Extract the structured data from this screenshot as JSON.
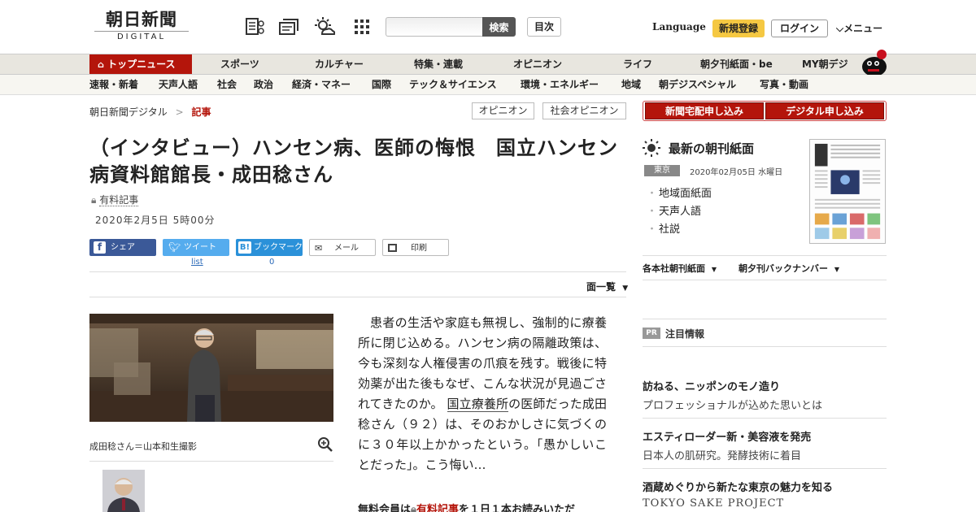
{
  "header": {
    "logo_main": "朝日新聞",
    "logo_sub": "DIGITAL",
    "search_button": "検索",
    "search_placeholder": "",
    "toc_button": "目次",
    "language": "Language",
    "signup": "新規登録",
    "login": "ログイン",
    "menu": "メニュー"
  },
  "nav_primary": [
    "トップニュース",
    "スポーツ",
    "カルチャー",
    "特集・連載",
    "オピニオン",
    "ライフ",
    "朝夕刊紙面・be",
    "MY朝デジ"
  ],
  "nav_secondary": [
    "速報・新着",
    "天声人語",
    "社会",
    "政治",
    "経済・マネー",
    "国際",
    "テック＆サイエンス",
    "環境・エネルギー",
    "地域",
    "朝デジスペシャル",
    "写真・動画"
  ],
  "breadcrumb": {
    "home": "朝日新聞デジタル",
    "separator": ">",
    "current": "記事"
  },
  "tags": [
    "オピニオン",
    "社会オピニオン"
  ],
  "article": {
    "headline": "（インタビュー）ハンセン病、医師の悔恨　国立ハンセン病資料館館長・成田稔さん",
    "paid_label": "有料記事",
    "date": "2020年2月5日 5時00分",
    "share": {
      "facebook": "シェア",
      "twitter": "ツイート",
      "hatena": "ブックマーク",
      "mail": "メール",
      "print": "印刷",
      "twitter_count": "list",
      "hatena_count": "0"
    },
    "page_list": "面一覧",
    "caption": "成田稔さん＝山本和生撮影",
    "body_before_link": "患者の生活や家庭も無視し、強制的に療養所に閉じ込める。ハンセン病の隔離政策は、今も深刻な人権侵害の爪痕を残す。戦後に特効薬が出た後もなぜ、こんな状況が見過ごされてきたのか。",
    "body_link": "国立療養所",
    "body_after_link": "の医師だった成田稔さん（９２）は、そのおかしさに気づくのに３０年以上かかったという。「愚かしいことだった」。こう悔い…",
    "free_note_a": "無料会員は",
    "free_note_link": "有料記事",
    "free_note_b": "を１日１本お読みいただ"
  },
  "sidebar": {
    "subscribe_paper": "新聞宅配申し込み",
    "subscribe_digital": "デジタル申し込み",
    "paper_title": "最新の朝刊紙面",
    "region": "東京",
    "paper_date": "2020年02月05日 水曜日",
    "paper_links": [
      "地域面紙面",
      "天声人語",
      "社説"
    ],
    "dropdown_1": "各本社朝刊紙面",
    "dropdown_2": "朝夕刊バックナンバー",
    "pr_label": "PR",
    "pr_title": "注目情報",
    "ads": [
      {
        "title": "訪ねる、ニッポンのモノ造り",
        "sub": "プロフェッショナルが込めた思いとは"
      },
      {
        "title": "エスティローダー新・美容液を発売",
        "sub": "日本人の肌研究。発酵技術に着目"
      },
      {
        "title": "酒蔵めぐりから新たな東京の魅力を知る",
        "sub": "TOKYO SAKE PROJECT"
      }
    ]
  },
  "colors": {
    "brand_red": "#b4150b",
    "facebook": "#3b5998",
    "twitter": "#55acee",
    "hatena": "#2b91d9",
    "signup_yellow": "#f5c842"
  }
}
